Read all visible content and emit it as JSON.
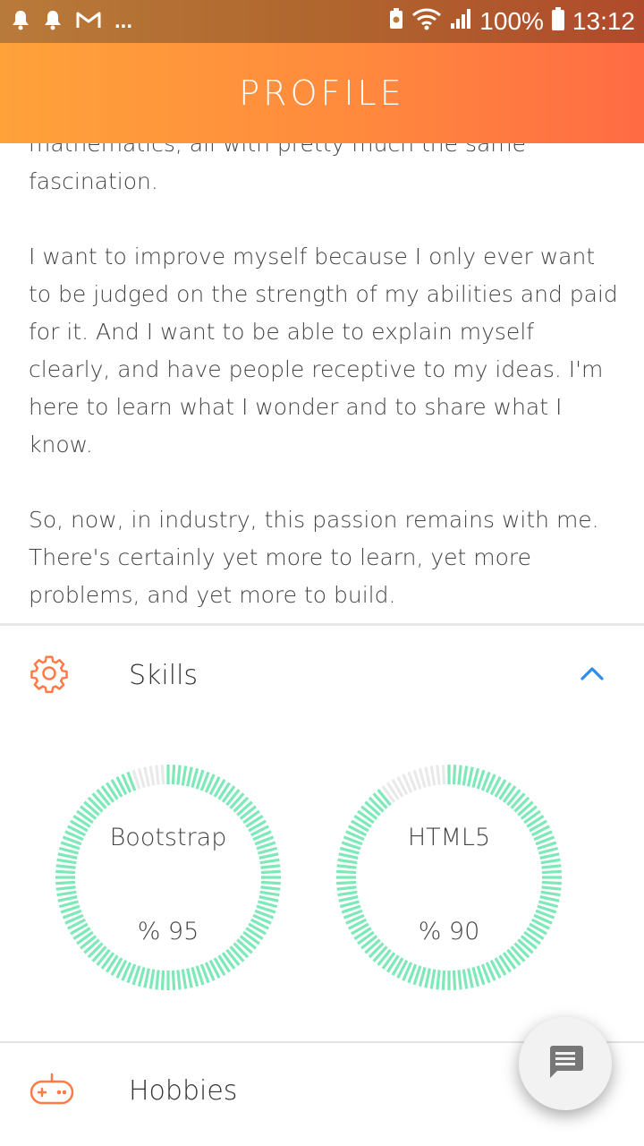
{
  "status_bar": {
    "battery": "100%",
    "time": "13:12",
    "ellipsis": "..."
  },
  "header": {
    "title": "PROFILE"
  },
  "about": {
    "paragraphs": [
      "mathematics, all with pretty much the same fascination.",
      "I want to improve myself because I only ever want to be judged on the strength of my abilities and paid for it. And I want to be able to explain myself clearly, and have people receptive to my ideas. I'm here to learn what I wonder and to share what I know.",
      "So, now, in industry, this passion remains with me. There's certainly yet more to learn, yet more problems, and yet more to build."
    ]
  },
  "skills_section": {
    "label": "Skills",
    "icon": "gear-icon",
    "expanded_icon": "chevron-up-icon",
    "items": [
      {
        "name": "Bootstrap",
        "value_text": "% 95",
        "percent": 95
      },
      {
        "name": "HTML5",
        "value_text": "% 90",
        "percent": 90
      }
    ]
  },
  "hobbies_section": {
    "label": "Hobbies",
    "icon": "gamepad-icon",
    "collapsed_icon": "chevron-down-icon"
  },
  "fab": {
    "icon": "chat-icon"
  },
  "colors": {
    "accent": "#ff7a45",
    "ring": "#7de8b8",
    "ring_empty": "#e9e9e9",
    "chevron": "#2e8bea"
  }
}
